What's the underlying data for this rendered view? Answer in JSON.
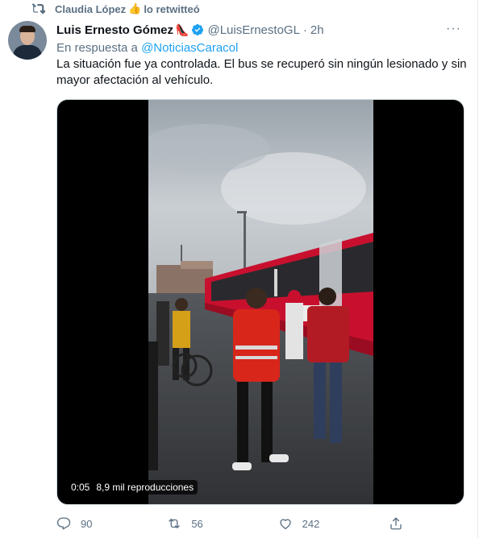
{
  "retweet": {
    "user": "Claudia López",
    "thumb": "👍",
    "action": "lo retwitteó"
  },
  "tweet": {
    "author_name": "Luis Ernesto Gómez",
    "author_emoji": "👠",
    "handle": "@LuisErnestoGL",
    "separator": "·",
    "time": "2h",
    "more": "···",
    "reply_prefix": "En respuesta a",
    "reply_mention": "@NoticiasCaracol",
    "text": "La situación fue ya controlada. El bus se recuperó sin ningún lesionado y sin mayor afectación al vehículo."
  },
  "video": {
    "time": "0:05",
    "views": "8,9 mil reproducciones"
  },
  "actions": {
    "reply_count": "90",
    "retweet_count": "56",
    "like_count": "242"
  },
  "colors": {
    "accent": "#1da1f2",
    "secondary_text": "#5b7083",
    "verified": "#1da1f2",
    "bus_red": "#c8102e"
  },
  "icons": {
    "retweet_bar": "retweet-icon",
    "verified": "verified-badge-icon",
    "more": "more-icon",
    "reply": "reply-icon",
    "retweet": "retweet-icon",
    "like": "heart-icon",
    "share": "share-icon"
  }
}
